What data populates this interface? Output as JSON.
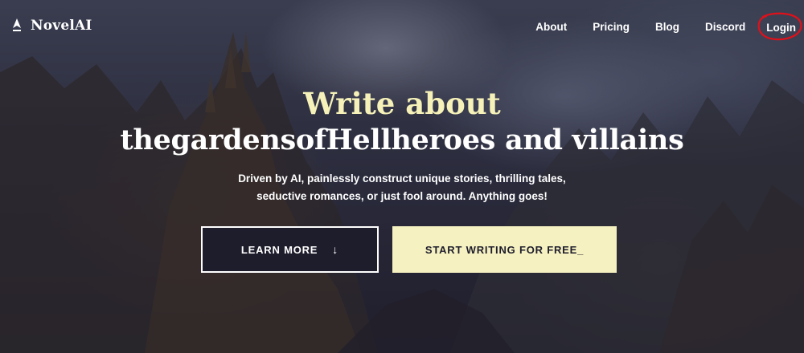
{
  "header": {
    "logo_text": "NovelAI",
    "nav": {
      "about": "About",
      "pricing": "Pricing",
      "blog": "Blog",
      "discord": "Discord",
      "login": "Login"
    }
  },
  "hero": {
    "title_line1": "Write about",
    "title_line2": "thegardensofHellheroes and villains",
    "subtitle_line1": "Driven by AI, painlessly construct unique stories, thrilling tales,",
    "subtitle_line2": "seductive romances, or just fool around. Anything goes!"
  },
  "buttons": {
    "learn_more": "LEARN MORE",
    "learn_more_icon": "arrow-down-icon",
    "start_writing": "START WRITING FOR FREE_"
  },
  "colors": {
    "accent": "#f5f1c0",
    "title_accent": "#f5f1b8",
    "dark": "#1e1d2c",
    "annotation": "#e0101a"
  }
}
